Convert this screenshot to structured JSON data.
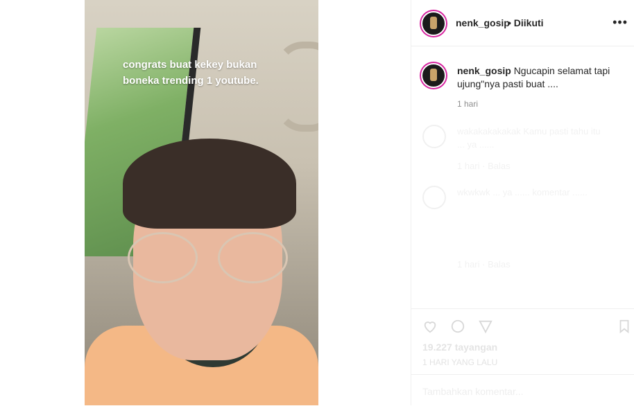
{
  "post": {
    "caption_overlay": "congrats buat kekey bukan boneka trending 1 youtube.",
    "header": {
      "username": "nenk_gosip",
      "follow_status": "• Diikuti",
      "more_glyph": "•••"
    },
    "caption": {
      "username": "nenk_gosip",
      "text": "Ngucapin selamat tapi ujung\"nya pasti buat ....",
      "time": "1 hari"
    },
    "faded_comments": [
      {
        "text": "wakakakakakak Kamu pasti tahu itu ... ya ......",
        "meta": "1 hari  ·  Balas"
      },
      {
        "text": "wkwkwk ... ya ...... komentar ......",
        "meta": "1 hari  ·  Balas"
      }
    ],
    "likes": "19.227 tayangan",
    "views": "1 HARI YANG LALU",
    "add_comment_placeholder": "Tambahkan komentar..."
  }
}
